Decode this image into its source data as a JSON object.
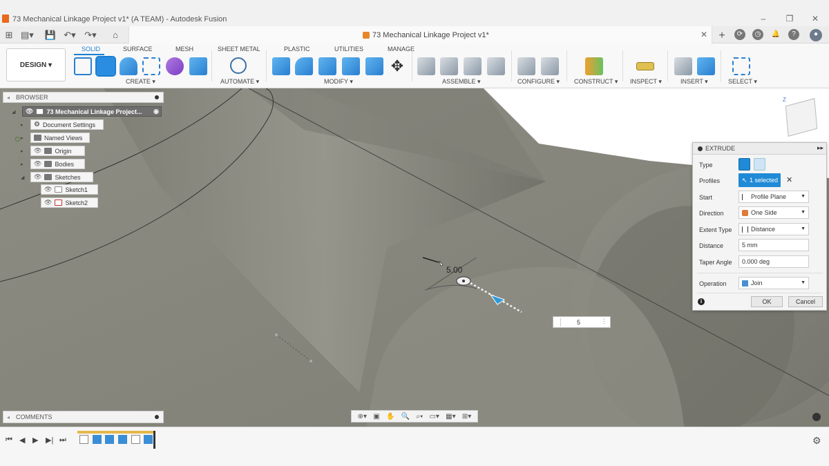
{
  "window": {
    "title": "73 Mechanical Linkage Project v1* (A TEAM) - Autodesk Fusion",
    "minimize_icon": "minimize-icon",
    "maximize_icon": "maximize-icon",
    "close_icon": "close-icon"
  },
  "tabbar": {
    "doc_tab_label": "73 Mechanical Linkage Project v1*"
  },
  "toolbar": {
    "design_label": "DESIGN ▾",
    "workspace_tabs": [
      "SOLID",
      "SURFACE",
      "MESH",
      "SHEET METAL",
      "PLASTIC",
      "UTILITIES",
      "MANAGE"
    ],
    "groups": [
      "CREATE ▾",
      "AUTOMATE ▾",
      "MODIFY ▾",
      "ASSEMBLE ▾",
      "CONFIGURE ▾",
      "CONSTRUCT ▾",
      "INSPECT ▾",
      "INSERT ▾",
      "SELECT ▾"
    ]
  },
  "browser": {
    "header": "BROWSER",
    "root": "73 Mechanical Linkage Project...",
    "items": [
      "Document Settings",
      "Named Views",
      "Origin",
      "Bodies",
      "Sketches",
      "Sketch1",
      "Sketch2"
    ]
  },
  "extrude": {
    "title": "EXTRUDE",
    "type_label": "Type",
    "profiles_label": "Profiles",
    "profiles_value": "1 selected",
    "start_label": "Start",
    "start_value": "Profile Plane",
    "direction_label": "Direction",
    "direction_value": "One Side",
    "extent_label": "Extent Type",
    "extent_value": "Distance",
    "distance_label": "Distance",
    "distance_value": "5 mm",
    "taper_label": "Taper Angle",
    "taper_value": "0.000 deg",
    "operation_label": "Operation",
    "operation_value": "Join",
    "ok_label": "OK",
    "cancel_label": "Cancel"
  },
  "manipulator": {
    "label": "5.00",
    "input_value": "5"
  },
  "comments": {
    "label": "COMMENTS"
  },
  "colors": {
    "accent": "#1b7ed1",
    "model_surface": "#8a8a80"
  }
}
